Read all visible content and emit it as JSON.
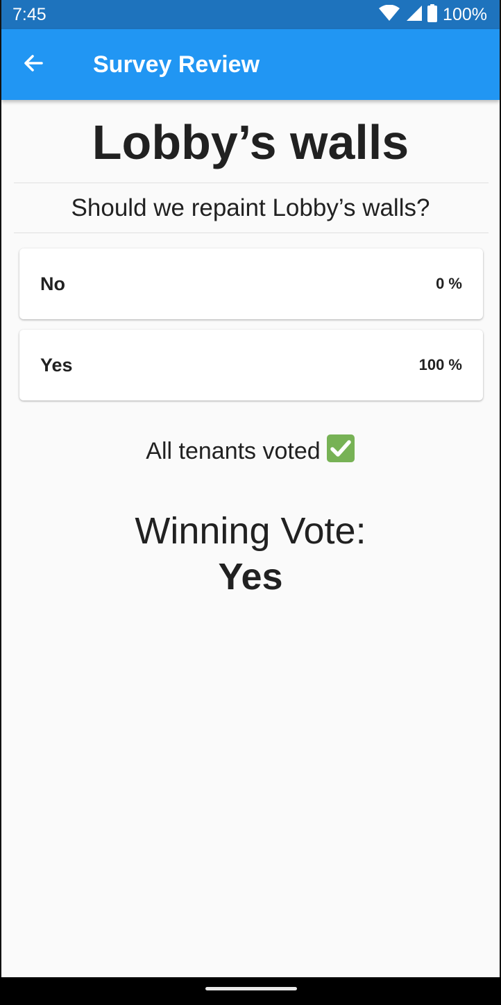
{
  "status_bar": {
    "time": "7:45",
    "battery": "100%",
    "icons": [
      "wifi-icon",
      "signal-icon",
      "battery-icon"
    ]
  },
  "app_bar": {
    "title": "Survey Review",
    "back_icon": "arrow-back-icon",
    "color": "#2196f3"
  },
  "survey": {
    "title": "Lobby’s walls",
    "question": "Should we repaint Lobby’s walls?",
    "options": [
      {
        "label": "No",
        "percent": "0 %"
      },
      {
        "label": "Yes",
        "percent": "100 %"
      }
    ],
    "vote_status": "All tenants voted",
    "vote_status_icon": "check-mark-icon",
    "winning_label": "Winning Vote:",
    "winning_value": "Yes"
  },
  "colors": {
    "status_bar": "#1e73bd",
    "app_bar": "#2196f3",
    "background": "#fafafa",
    "check_green": "#77b255"
  }
}
